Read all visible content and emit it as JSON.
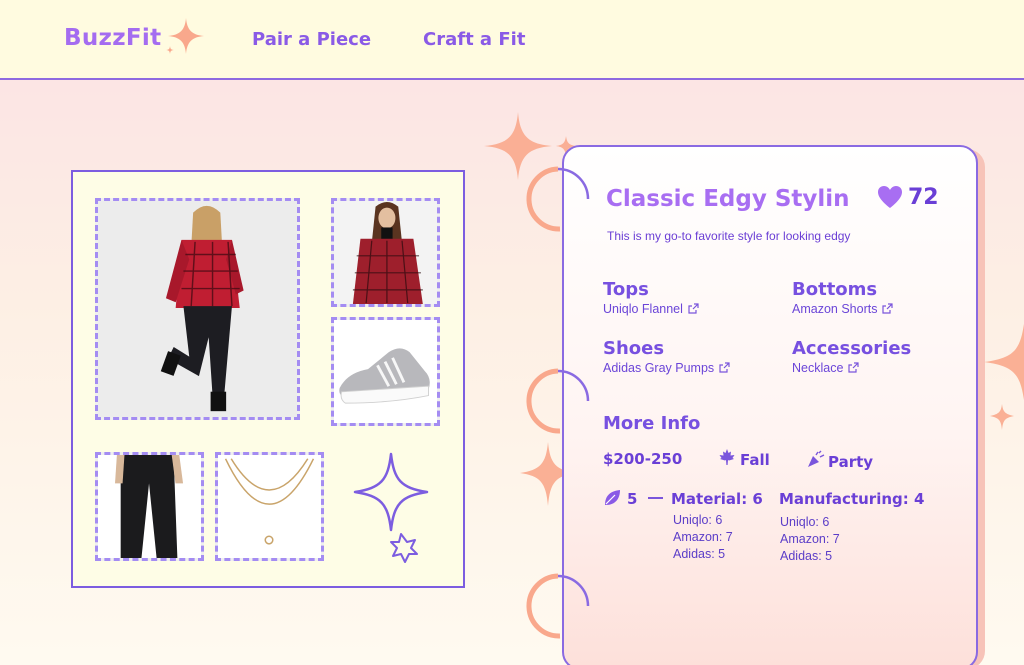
{
  "header": {
    "logo": "BuzzFit",
    "nav": [
      "Pair a Piece",
      "Craft a Fit"
    ]
  },
  "colors": {
    "accent": "#8a5ae6",
    "logo": "#a46cf0",
    "peach": "#f9a88c",
    "header_bg": "#fffbe0"
  },
  "collage": {
    "photos": [
      {
        "name": "full-outfit-photo",
        "alt": "Woman in red flannel shirt and black leather pants"
      },
      {
        "name": "flannel-top-photo",
        "alt": "Red plaid flannel shirt"
      },
      {
        "name": "sneaker-photo",
        "alt": "Gray knit sneaker"
      },
      {
        "name": "pants-photo",
        "alt": "Black pants"
      },
      {
        "name": "necklace-photo",
        "alt": "Gold layered necklace"
      }
    ]
  },
  "detail": {
    "title": "Classic Edgy Stylin",
    "likes": "72",
    "description": "This is my go-to favorite style for looking edgy",
    "categories": [
      {
        "label": "Tops",
        "item": "Uniqlo Flannel"
      },
      {
        "label": "Bottoms",
        "item": "Amazon Shorts"
      },
      {
        "label": "Shoes",
        "item": "Adidas Gray Pumps"
      },
      {
        "label": "Accessories",
        "item": "Necklace"
      }
    ],
    "more_info": {
      "heading": "More Info",
      "price": "$200-250",
      "season": "Fall",
      "occasion": "Party",
      "eco_score": "5",
      "material": {
        "title": "Material: 6",
        "lines": [
          "Uniqlo: 6",
          "Amazon: 7",
          "Adidas: 5"
        ]
      },
      "manufacturing": {
        "title": "Manufacturing: 4",
        "lines": [
          "Uniqlo: 6",
          "Amazon: 7",
          "Adidas: 5"
        ]
      }
    },
    "icons": {
      "heart": "heart-icon",
      "external": "external-link-icon",
      "season": "maple-leaf-icon",
      "occasion": "party-popper-icon",
      "eco": "leaf-icon"
    }
  }
}
